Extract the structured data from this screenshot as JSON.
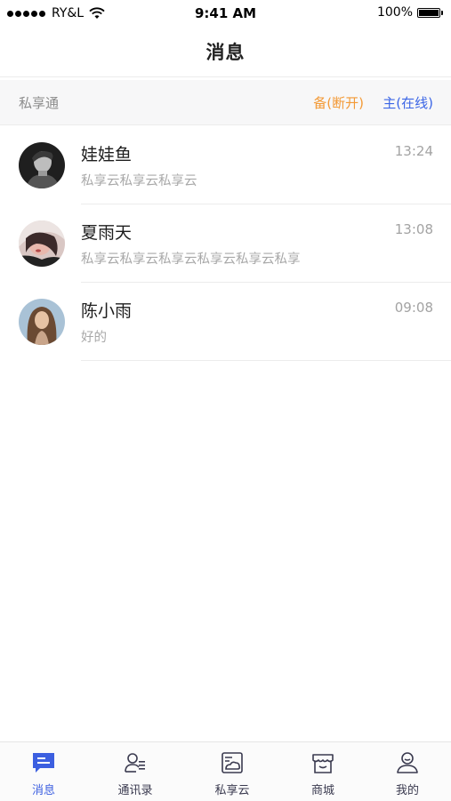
{
  "status_bar": {
    "carrier": "RY&L",
    "time": "9:41 AM",
    "battery": "100%"
  },
  "nav": {
    "title": "消息"
  },
  "section": {
    "label": "私享通",
    "backup_status": "备(断开)",
    "main_status": "主(在线)"
  },
  "conversations": [
    {
      "name": "娃娃鱼",
      "time": "13:24",
      "preview": "私享云私享云私享云"
    },
    {
      "name": "夏雨天",
      "time": "13:08",
      "preview": "私享云私享云私享云私享云私享云私享"
    },
    {
      "name": "陈小雨",
      "time": "09:08",
      "preview": "好的"
    }
  ],
  "tabs": [
    {
      "label": "消息",
      "icon": "message-icon",
      "active": true
    },
    {
      "label": "通讯录",
      "icon": "contacts-icon",
      "active": false
    },
    {
      "label": "私享云",
      "icon": "cloud-gallery-icon",
      "active": false
    },
    {
      "label": "商城",
      "icon": "store-icon",
      "active": false
    },
    {
      "label": "我的",
      "icon": "profile-icon",
      "active": false
    }
  ],
  "colors": {
    "accent": "#3c5fe0",
    "backup_status": "#f39a36",
    "main_status": "#3c66e6",
    "icon_inactive": "#3a3a4f"
  }
}
